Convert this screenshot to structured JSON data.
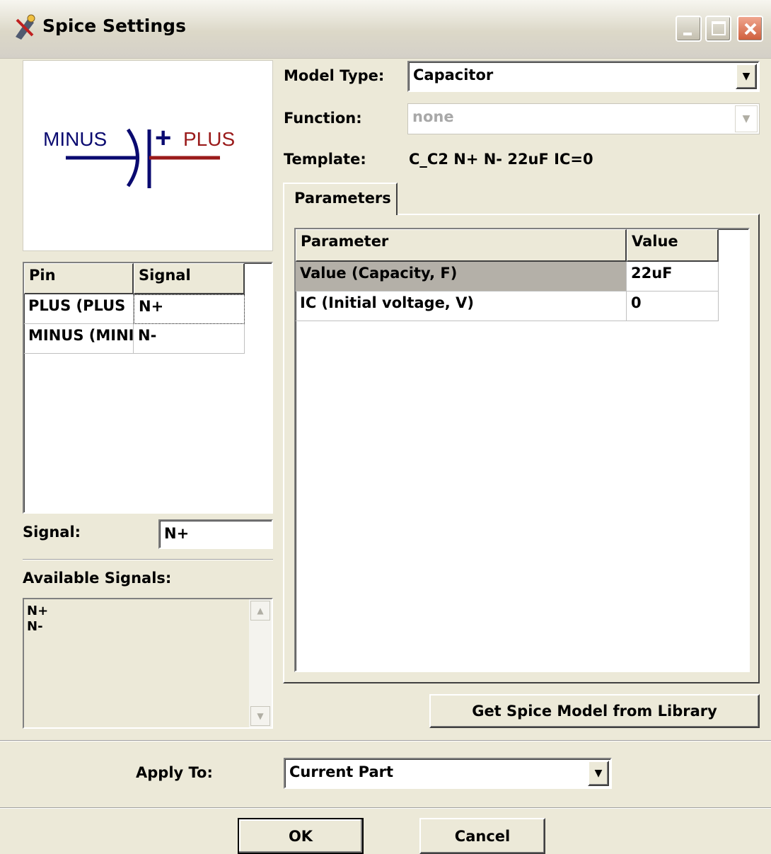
{
  "window": {
    "title": "Spice Settings"
  },
  "symbol": {
    "minus_label": "MINUS",
    "plus_sign": "+",
    "plus_label": "PLUS",
    "minus_color": "#0a0a70",
    "plus_color": "#9a1a1a"
  },
  "pin_table": {
    "headers": [
      "Pin",
      "Signal"
    ],
    "rows": [
      {
        "pin": "PLUS (PLUS",
        "signal": "N+"
      },
      {
        "pin": "MINUS (MINI",
        "signal": "N-"
      }
    ]
  },
  "signal": {
    "label": "Signal:",
    "value": "N+"
  },
  "available_signals": {
    "label": "Available Signals:",
    "items": [
      "N+",
      "N-"
    ]
  },
  "model_type": {
    "label": "Model Type:",
    "value": "Capacitor"
  },
  "function": {
    "label": "Function:",
    "value": "none"
  },
  "template": {
    "label": "Template:",
    "value": "C_C2 N+ N- 22uF IC=0"
  },
  "tabs": [
    {
      "label": "Parameters"
    }
  ],
  "param_table": {
    "headers": [
      "Parameter",
      "Value"
    ],
    "rows": [
      {
        "name": "Value (Capacity, F)",
        "value": "22uF"
      },
      {
        "name": "IC (Initial voltage, V)",
        "value": "0"
      }
    ]
  },
  "library_button": {
    "label": "Get Spice Model from Library"
  },
  "apply_to": {
    "label": "Apply To:",
    "value": "Current Part"
  },
  "buttons": {
    "ok": "OK",
    "cancel": "Cancel"
  }
}
